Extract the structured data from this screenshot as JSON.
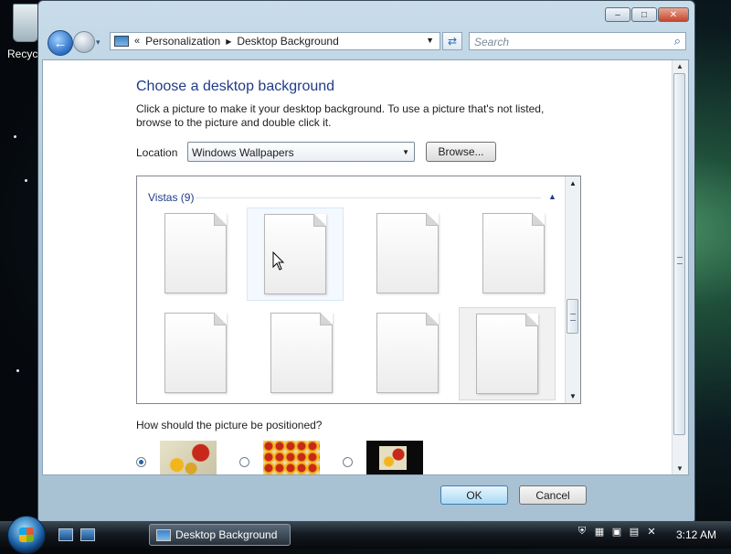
{
  "desktop": {
    "recycle_label": "Recyc"
  },
  "window": {
    "caption": {
      "minimize": "–",
      "maximize": "□",
      "close": "✕"
    },
    "nav": {
      "back": "←",
      "dropdown": "▾"
    },
    "address": {
      "chevrons": "«",
      "crumbs": [
        "Personalization",
        "Desktop Background"
      ],
      "separator": "▶",
      "dropdown": "▼"
    },
    "refresh": "⇄",
    "search": {
      "placeholder": "Search",
      "icon": "⌕"
    },
    "content": {
      "heading": "Choose a desktop background",
      "description": "Click a picture to make it your desktop background. To use a picture that's not listed, browse to the picture and double click it.",
      "location_label": "Location",
      "location_value": "Windows Wallpapers",
      "browse_label": "Browse...",
      "gallery": {
        "group_label": "Vistas (9)",
        "collapse_glyph": "▲",
        "items": [
          {
            "name": "wallpaper-1",
            "state": "normal"
          },
          {
            "name": "wallpaper-2",
            "state": "hover"
          },
          {
            "name": "wallpaper-3",
            "state": "normal"
          },
          {
            "name": "wallpaper-4",
            "state": "normal"
          },
          {
            "name": "wallpaper-5",
            "state": "normal"
          },
          {
            "name": "wallpaper-6",
            "state": "normal"
          },
          {
            "name": "wallpaper-7",
            "state": "normal"
          },
          {
            "name": "wallpaper-8",
            "state": "selected"
          }
        ]
      },
      "position_question": "How should the picture be positioned?",
      "position_options": [
        {
          "name": "fit-to-screen",
          "selected": true
        },
        {
          "name": "tile",
          "selected": false
        },
        {
          "name": "center",
          "selected": false
        }
      ]
    },
    "buttons": {
      "ok": "OK",
      "cancel": "Cancel"
    }
  },
  "taskbar": {
    "task_button_label": "Desktop Background",
    "clock": "3:12 AM"
  }
}
